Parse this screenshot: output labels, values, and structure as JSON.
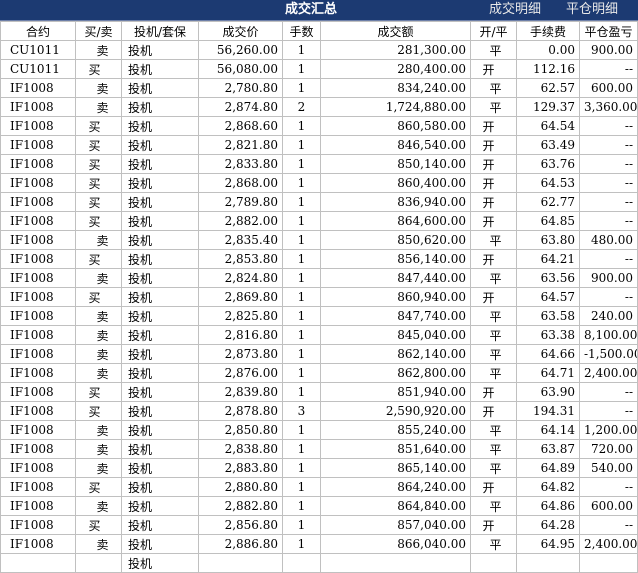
{
  "header": {
    "title": "成交汇总",
    "tab_detail": "成交明细",
    "tab_close": "平仓明细"
  },
  "columns": [
    "合约",
    "买/卖",
    "投机/套保",
    "成交价",
    "手数",
    "成交额",
    "开/平",
    "手续费",
    "平仓盈亏"
  ],
  "rows": [
    [
      "CU1011",
      "卖",
      "投机",
      "56,260.00",
      "1",
      "281,300.00",
      "平",
      "0.00",
      "900.00"
    ],
    [
      "CU1011",
      "买",
      "投机",
      "56,080.00",
      "1",
      "280,400.00",
      "开",
      "112.16",
      "--"
    ],
    [
      "IF1008",
      "卖",
      "投机",
      "2,780.80",
      "1",
      "834,240.00",
      "平",
      "62.57",
      "600.00"
    ],
    [
      "IF1008",
      "卖",
      "投机",
      "2,874.80",
      "2",
      "1,724,880.00",
      "平",
      "129.37",
      "3,360.00"
    ],
    [
      "IF1008",
      "买",
      "投机",
      "2,868.60",
      "1",
      "860,580.00",
      "开",
      "64.54",
      "--"
    ],
    [
      "IF1008",
      "买",
      "投机",
      "2,821.80",
      "1",
      "846,540.00",
      "开",
      "63.49",
      "--"
    ],
    [
      "IF1008",
      "买",
      "投机",
      "2,833.80",
      "1",
      "850,140.00",
      "开",
      "63.76",
      "--"
    ],
    [
      "IF1008",
      "买",
      "投机",
      "2,868.00",
      "1",
      "860,400.00",
      "开",
      "64.53",
      "--"
    ],
    [
      "IF1008",
      "买",
      "投机",
      "2,789.80",
      "1",
      "836,940.00",
      "开",
      "62.77",
      "--"
    ],
    [
      "IF1008",
      "买",
      "投机",
      "2,882.00",
      "1",
      "864,600.00",
      "开",
      "64.85",
      "--"
    ],
    [
      "IF1008",
      "卖",
      "投机",
      "2,835.40",
      "1",
      "850,620.00",
      "平",
      "63.80",
      "480.00"
    ],
    [
      "IF1008",
      "买",
      "投机",
      "2,853.80",
      "1",
      "856,140.00",
      "开",
      "64.21",
      "--"
    ],
    [
      "IF1008",
      "卖",
      "投机",
      "2,824.80",
      "1",
      "847,440.00",
      "平",
      "63.56",
      "900.00"
    ],
    [
      "IF1008",
      "买",
      "投机",
      "2,869.80",
      "1",
      "860,940.00",
      "开",
      "64.57",
      "--"
    ],
    [
      "IF1008",
      "卖",
      "投机",
      "2,825.80",
      "1",
      "847,740.00",
      "平",
      "63.58",
      "240.00"
    ],
    [
      "IF1008",
      "卖",
      "投机",
      "2,816.80",
      "1",
      "845,040.00",
      "平",
      "63.38",
      "8,100.00"
    ],
    [
      "IF1008",
      "卖",
      "投机",
      "2,873.80",
      "1",
      "862,140.00",
      "平",
      "64.66",
      "-1,500.00"
    ],
    [
      "IF1008",
      "卖",
      "投机",
      "2,876.00",
      "1",
      "862,800.00",
      "平",
      "64.71",
      "2,400.00"
    ],
    [
      "IF1008",
      "买",
      "投机",
      "2,839.80",
      "1",
      "851,940.00",
      "开",
      "63.90",
      "--"
    ],
    [
      "IF1008",
      "买",
      "投机",
      "2,878.80",
      "3",
      "2,590,920.00",
      "开",
      "194.31",
      "--"
    ],
    [
      "IF1008",
      "卖",
      "投机",
      "2,850.80",
      "1",
      "855,240.00",
      "平",
      "64.14",
      "1,200.00"
    ],
    [
      "IF1008",
      "卖",
      "投机",
      "2,838.80",
      "1",
      "851,640.00",
      "平",
      "63.87",
      "720.00"
    ],
    [
      "IF1008",
      "卖",
      "投机",
      "2,883.80",
      "1",
      "865,140.00",
      "平",
      "64.89",
      "540.00"
    ],
    [
      "IF1008",
      "买",
      "投机",
      "2,880.80",
      "1",
      "864,240.00",
      "开",
      "64.82",
      "--"
    ],
    [
      "IF1008",
      "卖",
      "投机",
      "2,882.80",
      "1",
      "864,840.00",
      "平",
      "64.86",
      "600.00"
    ],
    [
      "IF1008",
      "买",
      "投机",
      "2,856.80",
      "1",
      "857,040.00",
      "开",
      "64.28",
      "--"
    ],
    [
      "IF1008",
      "卖",
      "投机",
      "2,886.80",
      "1",
      "866,040.00",
      "平",
      "64.95",
      "2,400.00"
    ],
    [
      "",
      "",
      "投机",
      "",
      "",
      "",
      "",
      "",
      ""
    ]
  ],
  "colors": {
    "header_bg": "#1c3a72",
    "grid": "#c0c0c0"
  }
}
